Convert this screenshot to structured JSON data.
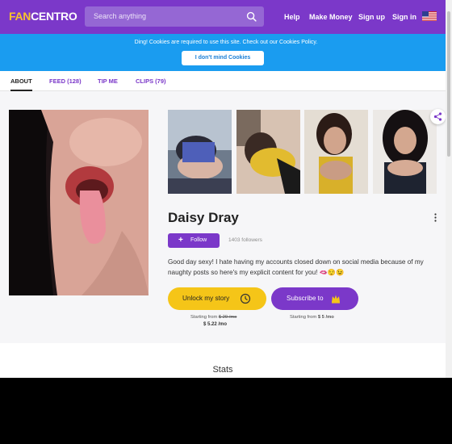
{
  "header": {
    "logo_part1": "FAN",
    "logo_part2": "CENTRO",
    "search_placeholder": "Search anything",
    "nav": [
      "Help",
      "Make Money",
      "Sign up",
      "Sign in"
    ]
  },
  "cookie_banner": {
    "message": "Ding! Cookies are required to use this site. Check out our Cookies Policy.",
    "button": "I don't mind Cookies"
  },
  "tabs": [
    {
      "label": "ABOUT",
      "active": true
    },
    {
      "label": "FEED (128)",
      "active": false
    },
    {
      "label": "TIP ME",
      "active": false
    },
    {
      "label": "CLIPS (79)",
      "active": false
    }
  ],
  "profile": {
    "name": "Daisy Dray",
    "follow_label": "Follow",
    "followers": "1403 followers",
    "bio": "Good day sexy! I hate having my accounts closed down on social media because of my naughty posts so here's my explicit content for you! 🫦😌😉"
  },
  "actions": {
    "unlock": {
      "label": "Unlock my story",
      "price_prefix": "Starting from",
      "old_price": "$ 29 /mo",
      "price": "$ 5.22 /mo"
    },
    "subscribe": {
      "label": "Subscribe to",
      "price_prefix": "Starting from",
      "price": "$ 5 /mo"
    }
  },
  "stats_title": "Stats",
  "colors": {
    "brand": "#7b38c9",
    "banner": "#1a9cf0",
    "accent_yellow": "#f5c518"
  }
}
